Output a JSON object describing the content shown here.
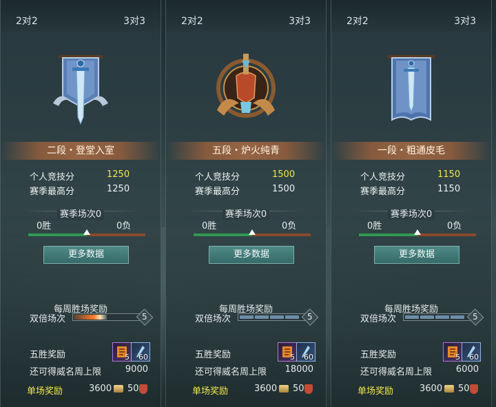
{
  "colors": {
    "highlight": "#f2e84a",
    "win_bar": "#2f9a52",
    "loss_bar": "#8a4b2a",
    "rank_banner": "#a0694a"
  },
  "panels": [
    {
      "tabs": [
        "2对2",
        "3对3"
      ],
      "rank_name": "二段・登堂入室",
      "emblem_icon": "blue-banner-sword-emblem",
      "score_label": "个人竞技分",
      "score_value": "1250",
      "best_label": "赛季最高分",
      "best_value": "1250",
      "season_label": "赛季场次0",
      "wins": "0胜",
      "losses": "0负",
      "win_fraction": 0.5,
      "more_button": "更多数据",
      "weekly_label": "每周胜场奖励",
      "double_label": "双倍场次",
      "double_value": "5",
      "double_fraction": 0.5,
      "five_win_label": "五胜奖励",
      "item1_count": "5",
      "item2_count": "60",
      "limit_label": "还可得威名周上限",
      "limit_value": "9000",
      "single_label": "单场奖励",
      "reward_coin": "3600",
      "reward_shield": "50"
    },
    {
      "tabs": [
        "2对2",
        "3对3"
      ],
      "rank_name": "五段・炉火纯青",
      "emblem_icon": "bronze-winged-helm-emblem",
      "score_label": "个人竞技分",
      "score_value": "1500",
      "best_label": "赛季最高分",
      "best_value": "1500",
      "season_label": "赛季场次0",
      "wins": "0胜",
      "losses": "0负",
      "win_fraction": 0.5,
      "more_button": "更多数据",
      "weekly_label": "每周胜场奖励",
      "double_label": "双倍场次",
      "double_value": "5",
      "double_fraction": 0,
      "five_win_label": "五胜奖励",
      "item1_count": "5",
      "item2_count": "60",
      "limit_label": "还可得威名周上限",
      "limit_value": "18000",
      "single_label": "单场奖励",
      "reward_coin": "3600",
      "reward_shield": "50"
    },
    {
      "tabs": [
        "2对2",
        "3对3"
      ],
      "rank_name": "一段・粗通皮毛",
      "emblem_icon": "blue-banner-emblem",
      "score_label": "个人竞技分",
      "score_value": "1150",
      "best_label": "赛季最高分",
      "best_value": "1150",
      "season_label": "赛季场次0",
      "wins": "0胜",
      "losses": "0负",
      "win_fraction": 0.5,
      "more_button": "更多数据",
      "weekly_label": "每周胜场奖励",
      "double_label": "双倍场次",
      "double_value": "5",
      "double_fraction": 0,
      "five_win_label": "五胜奖励",
      "item1_count": "5",
      "item2_count": "60",
      "limit_label": "还可得威名周上限",
      "limit_value": "6000",
      "single_label": "单场奖励",
      "reward_coin": "3600",
      "reward_shield": "50"
    }
  ]
}
